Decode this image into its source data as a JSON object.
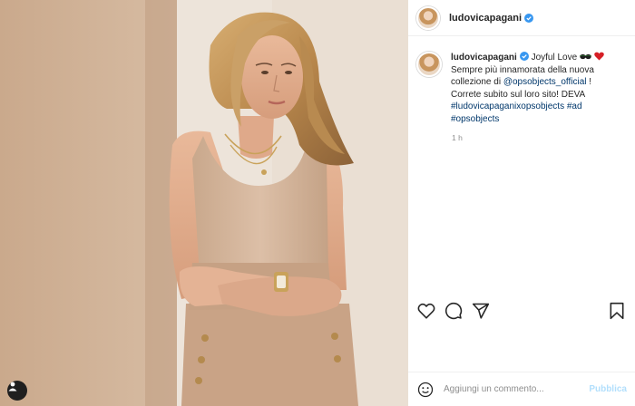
{
  "post": {
    "username": "ludovicapagani",
    "verified": true,
    "caption": {
      "text_1": "Joyful Love",
      "text_2": "Sempre più innamorata della nuova collezione di",
      "mention": "@opsobjects_official",
      "text_3": "! Correte subito sul loro sito! DEVA",
      "hashtag_1": "#ludovicapaganixopsobjects",
      "hashtag_2": "#ad",
      "hashtag_3": "#opsobjects"
    },
    "timestamp": "1 h"
  },
  "comment_box": {
    "placeholder": "Aggiungi un commento...",
    "publish_label": "Pubblica"
  },
  "colors": {
    "verified_blue": "#3897f0",
    "link": "#00376b",
    "publish_disabled": "#b2dffc"
  },
  "icons": {
    "like": "heart-icon",
    "comment": "comment-icon",
    "share": "paper-plane-icon",
    "save": "bookmark-icon",
    "emoji": "smiley-icon",
    "tags": "user-tag-icon"
  }
}
